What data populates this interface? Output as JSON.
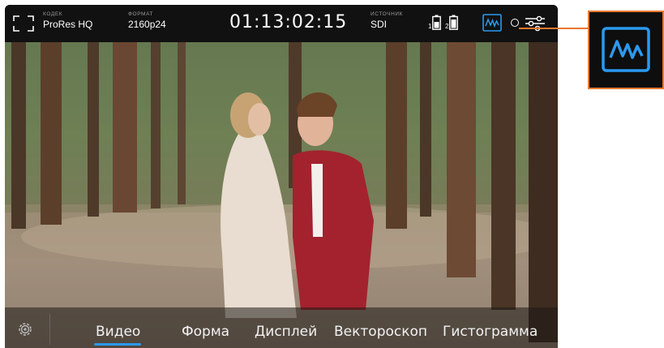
{
  "topbar": {
    "codec_caption": "КОДЕК",
    "codec_value": "ProRes HQ",
    "format_caption": "ФОРМАТ",
    "format_value": "2160p24",
    "timecode": "01:13:02:15",
    "source_caption": "ИСТОЧНИК",
    "source_value": "SDI",
    "battery_1": "1",
    "battery_2": "2"
  },
  "tabs": [
    {
      "label": "Видео",
      "active": true
    },
    {
      "label": "Форма",
      "active": false
    },
    {
      "label": "Дисплей",
      "active": false
    },
    {
      "label": "Вектороскоп",
      "active": false
    },
    {
      "label": "Гистограмма",
      "active": false
    }
  ],
  "colors": {
    "accent": "#2a9af0",
    "callout": "#e9792d"
  },
  "icons": {
    "fullscreen": "fullscreen-icon",
    "waveform": "waveform-icon",
    "settings": "sliders-icon",
    "gear": "gear-icon"
  }
}
